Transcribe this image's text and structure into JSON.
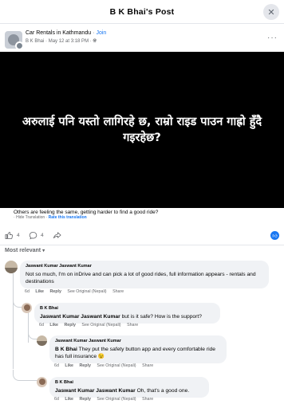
{
  "header": {
    "title": "B K Bhai's Post",
    "close_glyph": "✕"
  },
  "post": {
    "group_name": "Car Rentals in Kathmandu",
    "join_label": "Join",
    "author": "B K Bhai",
    "date": "May 12 at 3:18 PM",
    "more_glyph": "···",
    "image_caption": "अरुलाई पनि यस्तो लागिरहे छ, राम्रो राइड पाउन गाह्रो हुँदै गइरहेछ?",
    "translated_text": "Others are feeling the same, getting harder to find a good ride?",
    "hide_translation": "Hide Translation",
    "rate_translation": "Rate this translation",
    "likes_count": "4",
    "comments_count": "4"
  },
  "sort_label": "Most relevant",
  "comments": [
    {
      "author": "Jaswant Kumar Jaswant Kumar",
      "text": "Not so much, I'm on inDrive and can pick a lot of good rides, full information appears - rentals and destinations",
      "time": "6d",
      "like": "Like",
      "reply": "Reply",
      "see_original": "See Original (Nepali)",
      "share": "Share"
    },
    {
      "author": "B K Bhai",
      "mention": "Jaswant Kumar Jaswant Kumar",
      "text": " but is it safe? How is the support?",
      "time": "6d",
      "like": "Like",
      "reply": "Reply",
      "see_original": "See Original (Nepali)",
      "share": "Share"
    },
    {
      "author": "Jaswant Kumar Jaswant Kumar",
      "mention": "B K Bhai",
      "text": " They put the safety button app and every comfortable ride has full insurance 😉",
      "time": "6d",
      "like": "Like",
      "reply": "Reply",
      "see_original": "See Original (Nepali)",
      "share": "Share"
    },
    {
      "author": "B K Bhai",
      "mention": "Jaswant Kumar Jaswant Kumar",
      "text": " Oh, that's a good one.",
      "time": "6d",
      "like": "Like",
      "reply": "Reply",
      "see_original": "See Original (Nepali)",
      "share": "Share"
    }
  ],
  "colors": {
    "accent": "#1877f2",
    "muted": "#65676b",
    "bubble": "#f0f2f5"
  }
}
